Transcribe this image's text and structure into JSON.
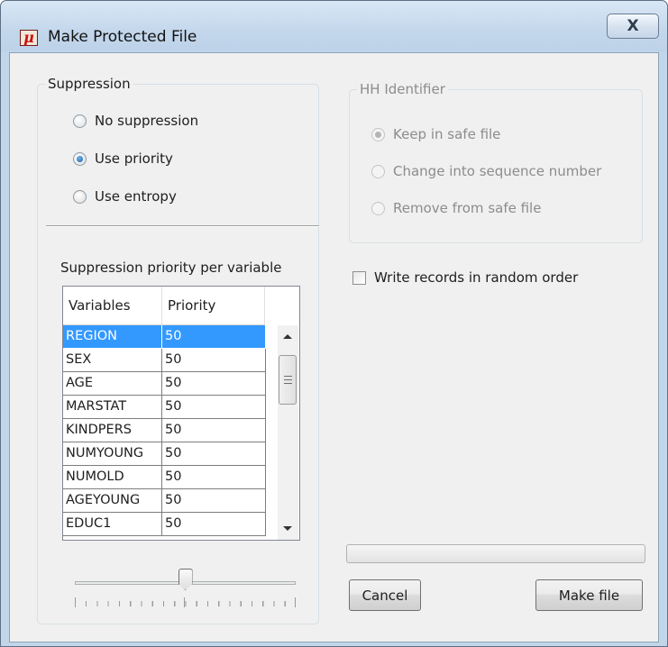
{
  "window": {
    "title": "Make Protected File",
    "close_glyph": "X",
    "app_icon_glyph": "μ"
  },
  "suppression": {
    "legend": "Suppression",
    "options": [
      {
        "label": "No suppression",
        "checked": false
      },
      {
        "label": "Use priority",
        "checked": true
      },
      {
        "label": "Use entropy",
        "checked": false
      }
    ],
    "priority_label": "Suppression priority per variable",
    "table": {
      "headers": [
        "Variables",
        "Priority"
      ],
      "rows": [
        {
          "variable": "REGION",
          "priority": "50",
          "selected": true
        },
        {
          "variable": "SEX",
          "priority": "50",
          "selected": false
        },
        {
          "variable": "AGE",
          "priority": "50",
          "selected": false
        },
        {
          "variable": "MARSTAT",
          "priority": "50",
          "selected": false
        },
        {
          "variable": "KINDPERS",
          "priority": "50",
          "selected": false
        },
        {
          "variable": "NUMYOUNG",
          "priority": "50",
          "selected": false
        },
        {
          "variable": "NUMOLD",
          "priority": "50",
          "selected": false
        },
        {
          "variable": "AGEYOUNG",
          "priority": "50",
          "selected": false
        },
        {
          "variable": "EDUC1",
          "priority": "50",
          "selected": false
        }
      ]
    },
    "slider_level": 0.5
  },
  "hh_identifier": {
    "legend": "HH Identifier",
    "enabled": false,
    "options": [
      {
        "label": "Keep in safe file",
        "checked": true
      },
      {
        "label": "Change into sequence number",
        "checked": false
      },
      {
        "label": "Remove from safe file",
        "checked": false
      }
    ]
  },
  "random_order": {
    "label": "Write records in random order",
    "checked": false
  },
  "progress": {
    "value": 0
  },
  "buttons": {
    "cancel": "Cancel",
    "make_file": "Make file"
  },
  "colors": {
    "selection": "#3399ff",
    "title_bar": "#c3d7ec",
    "client_background": "#f0f0f0"
  },
  "icons": {
    "close": "close-icon",
    "app": "mu-argus-app-icon",
    "scroll_up": "scroll-up-arrow-icon",
    "scroll_down": "scroll-down-arrow-icon"
  }
}
